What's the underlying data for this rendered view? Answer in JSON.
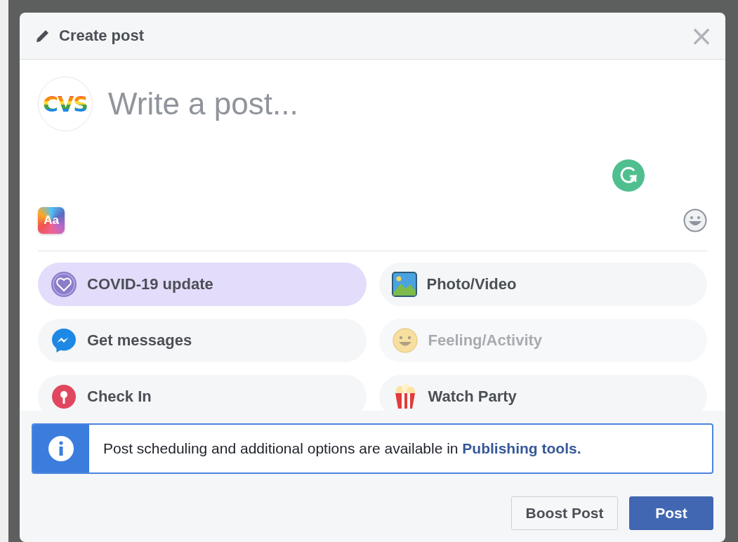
{
  "dialog": {
    "title": "Create post",
    "close": "×"
  },
  "composer": {
    "avatar_text": "CVS",
    "placeholder": "Write a post...",
    "text_style": "Aa"
  },
  "options": [
    {
      "label": "COVID-19 update",
      "kind": "covid",
      "selected": true,
      "disabled": false
    },
    {
      "label": "Photo/Video",
      "kind": "photo",
      "selected": false,
      "disabled": false
    },
    {
      "label": "Get messages",
      "kind": "messenger",
      "selected": false,
      "disabled": false
    },
    {
      "label": "Feeling/Activity",
      "kind": "feeling",
      "selected": false,
      "disabled": true
    },
    {
      "label": "Check In",
      "kind": "checkin",
      "selected": false,
      "disabled": false
    },
    {
      "label": "Watch Party",
      "kind": "watch",
      "selected": false,
      "disabled": false
    }
  ],
  "info": {
    "text": "Post scheduling and additional options are available in ",
    "link": "Publishing tools."
  },
  "buttons": [
    {
      "label": "Boost Post",
      "kind": "secondary"
    },
    {
      "label": "Post",
      "kind": "primary"
    }
  ]
}
